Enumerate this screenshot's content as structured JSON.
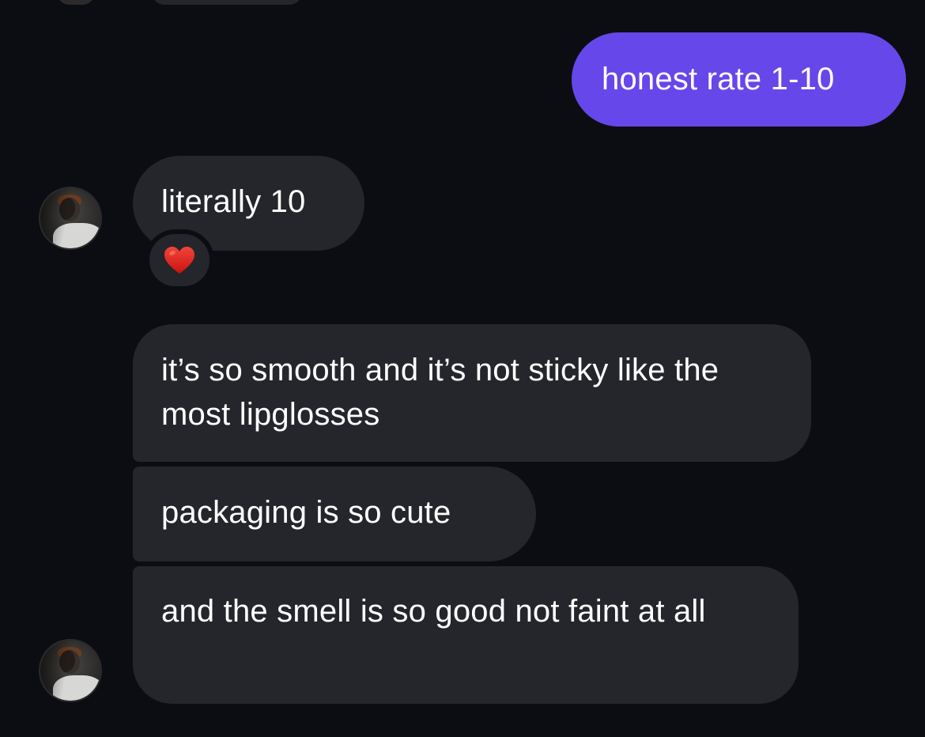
{
  "messages": {
    "outgoing_1": "honest rate 1-10",
    "incoming_1": "literally 10",
    "incoming_2": "it’s so smooth and it’s not sticky like the most lipglosses",
    "incoming_3": "packaging is so cute",
    "incoming_4": "and the smell is so good not faint at all"
  },
  "reaction": {
    "icon": "red-heart",
    "color": "#e0241b"
  },
  "colors": {
    "background": "#0c0d12",
    "incoming_bubble": "#25262b",
    "outgoing_bubble": "#6647ea",
    "text": "#ffffff"
  }
}
